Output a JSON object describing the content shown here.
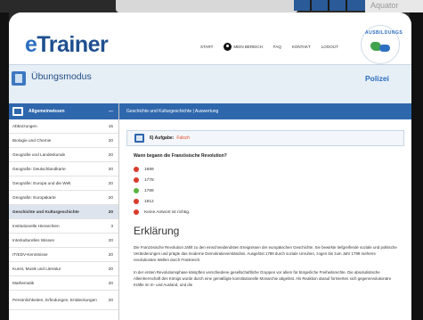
{
  "background": {
    "brand_fragment": "Aquator"
  },
  "header": {
    "logo_prefix": "e",
    "logo_text": "Trainer",
    "nav": [
      "START",
      "MEIN BEREICH",
      "FAQ",
      "KONTAKT",
      "LOGOUT"
    ],
    "seal_text": "AUSBILDUNGS"
  },
  "modebar": {
    "title": "Übungsmodus",
    "right_label": "Polizei"
  },
  "sidebar": {
    "header": {
      "label": "Allgemeinwissen",
      "count": "---"
    },
    "items": [
      {
        "label": "Abkürzungen",
        "count": "15"
      },
      {
        "label": "Biologie und Chemie",
        "count": "20"
      },
      {
        "label": "Geografie und Landeskunde",
        "count": "20"
      },
      {
        "label": "Geografie: Deutschlandkarte",
        "count": "20"
      },
      {
        "label": "Geografie: Europa und die Welt",
        "count": "20"
      },
      {
        "label": "Geografie: Europakarte",
        "count": "20"
      },
      {
        "label": "Geschichte und Kulturgeschichte",
        "count": "20",
        "selected": true
      },
      {
        "label": "Institutionelle Hierarchien",
        "count": "3"
      },
      {
        "label": "Interkulturelles Wissen",
        "count": "20"
      },
      {
        "label": "IT/EDV-Kenntnisse",
        "count": "20"
      },
      {
        "label": "Kunst, Musik und Literatur",
        "count": "20"
      },
      {
        "label": "Mathematik",
        "count": "20"
      },
      {
        "label": "Persönlichkeiten, Erfindungen, Entdeckungen",
        "count": "20"
      }
    ]
  },
  "main": {
    "breadcrumb": "Geschichte und Kulturgeschichte | Auswertung",
    "task_label": "6) Aufgabe:",
    "task_status": "Falsch",
    "question": "Wann begann die Französische Revolution?",
    "answers": [
      {
        "text": "1689",
        "color": "#d93b2b"
      },
      {
        "text": "1778",
        "color": "#d93b2b"
      },
      {
        "text": "1789",
        "color": "#5bb33f"
      },
      {
        "text": "1812",
        "color": "#d93b2b"
      },
      {
        "text": "Keine Antwort ist richtig.",
        "color": "#d93b2b"
      }
    ],
    "explanation_heading": "Erklärung",
    "paragraphs": [
      "Die Französische Revolution zählt zu den einschneidendsten Ereignissen der europäischen Geschichte. Sie bewirkte tiefgreifende soziale und politische Veränderungen und prägte das moderne Demokratieverständnis. Ausgelöst 1789 durch soziale Unruhen, zogen bis zum Jahr 1799 mehrere revolutionäre Wellen durch Frankreich.",
      "In der ersten Revolutionsphase kämpften verschiedene gesellschaftliche Gruppen vor allem für bürgerliche Freiheitsrechte. Die absolutistische Alleinherrschaft des Königs wurde durch eine gemäßigte konstitutionelle Monarchie abgelöst. Als Reaktion darauf formierten sich gegenrevolutionäre Kräfte im In- und Ausland, und die"
    ]
  }
}
